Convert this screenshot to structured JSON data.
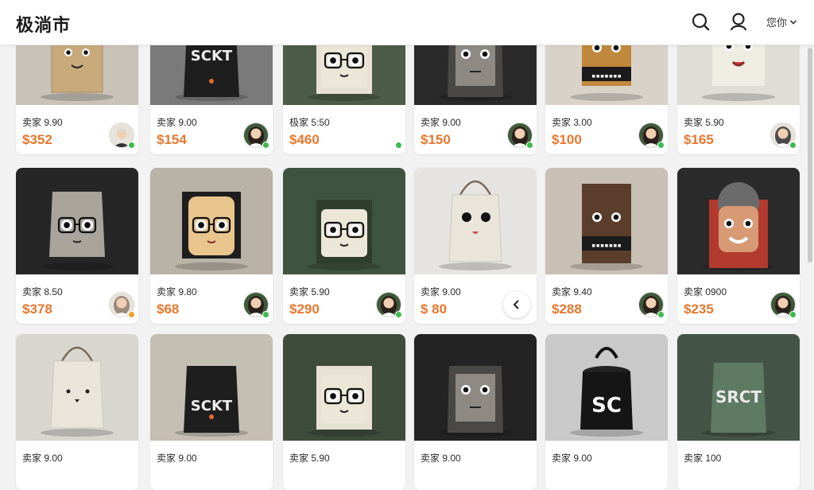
{
  "header": {
    "app_title": "极淌市",
    "search_icon": "search-icon",
    "profile_icon": "user-icon",
    "user_menu_label": "您你"
  },
  "nav": {
    "prev_icon": "chevron-left-icon"
  },
  "colors": {
    "price": "#e8772e",
    "online_green": "#3dbb4f",
    "online_orange": "#f0a22c"
  },
  "rows": [
    {
      "cards": [
        {
          "seller": "卖家 9.90",
          "price": "$352",
          "status": "online"
        },
        {
          "seller": "卖家 9.00",
          "price": "$154",
          "status": "online"
        },
        {
          "seller": "极家 5:50",
          "price": "$460",
          "status": "online"
        },
        {
          "seller": "卖家 9.00",
          "price": "$150",
          "status": "online"
        },
        {
          "seller": "卖家 3.00",
          "price": "$100",
          "status": "online"
        },
        {
          "seller": "卖家 5.90",
          "price": "$165",
          "status": "online"
        }
      ]
    },
    {
      "cards": [
        {
          "seller": "卖家 8.50",
          "price": "$378",
          "status": "away"
        },
        {
          "seller": "卖家 9.80",
          "price": "$68",
          "status": "online"
        },
        {
          "seller": "卖家 5.90",
          "price": "$290",
          "status": "online"
        },
        {
          "seller": "卖家 9.00",
          "price": "$ 80",
          "status": "none"
        },
        {
          "seller": "卖家 9.40",
          "price": "$288",
          "status": "online"
        },
        {
          "seller": "卖家 0900",
          "price": "$235",
          "status": "online"
        }
      ]
    },
    {
      "cards": [
        {
          "seller": "卖家 9.00",
          "price": "",
          "status": "none"
        },
        {
          "seller": "卖家 9.00",
          "price": "",
          "status": "none"
        },
        {
          "seller": "卖家 5.90",
          "price": "",
          "status": "none"
        },
        {
          "seller": "卖家 9.00",
          "price": "",
          "status": "none"
        },
        {
          "seller": "卖家 9.00",
          "price": "",
          "status": "none"
        },
        {
          "seller": "卖家 100",
          "price": "",
          "status": "none"
        }
      ]
    }
  ],
  "bag_labels": {
    "sckt": "SCKT",
    "sc": "SC",
    "srct": "SRCT"
  }
}
